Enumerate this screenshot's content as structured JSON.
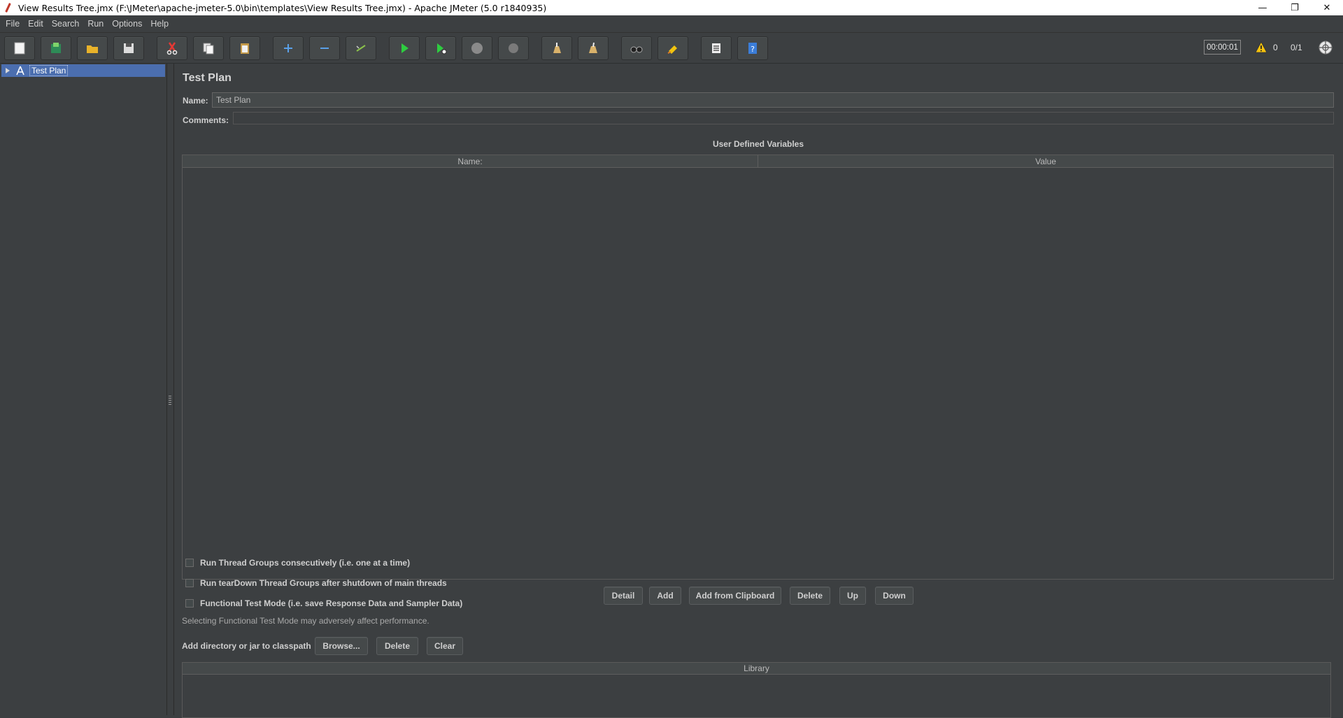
{
  "window": {
    "title": "View Results Tree.jmx (F:\\JMeter\\apache-jmeter-5.0\\bin\\templates\\View Results Tree.jmx) - Apache JMeter (5.0 r1840935)",
    "minimize": "—",
    "restore": "❐",
    "close": "✕"
  },
  "menu": {
    "items": [
      {
        "label": "File"
      },
      {
        "label": "Edit"
      },
      {
        "label": "Search"
      },
      {
        "label": "Run"
      },
      {
        "label": "Options"
      },
      {
        "label": "Help"
      }
    ]
  },
  "toolbar": {
    "timer": "00:00:01",
    "warning_count": "0",
    "threads": "0/1"
  },
  "tree": {
    "root_label": "Test Plan"
  },
  "test_plan": {
    "title": "Test Plan",
    "name_label": "Name:",
    "name_value": "Test Plan",
    "comments_label": "Comments:",
    "variables_title": "User Defined Variables",
    "columns": [
      "Name:",
      "Value"
    ],
    "buttons": {
      "detail": "Detail",
      "add": "Add",
      "add_from_clipboard": "Add from Clipboard",
      "delete": "Delete",
      "up": "Up",
      "down": "Down"
    },
    "options": [
      {
        "label": "Run Thread Groups consecutively (i.e. one at a time)",
        "checked": false
      },
      {
        "label": "Run tearDown Thread Groups after shutdown of main threads",
        "checked": false
      },
      {
        "label": "Functional Test Mode (i.e. save Response Data and Sampler Data)",
        "checked": false
      }
    ],
    "functional_note": "Selecting Functional Test Mode may adversely affect performance.",
    "classpath_label": "Add directory or jar to classpath",
    "classpath_buttons": {
      "browse": "Browse...",
      "delete": "Delete",
      "clear": "Clear"
    },
    "library_column": "Library"
  }
}
